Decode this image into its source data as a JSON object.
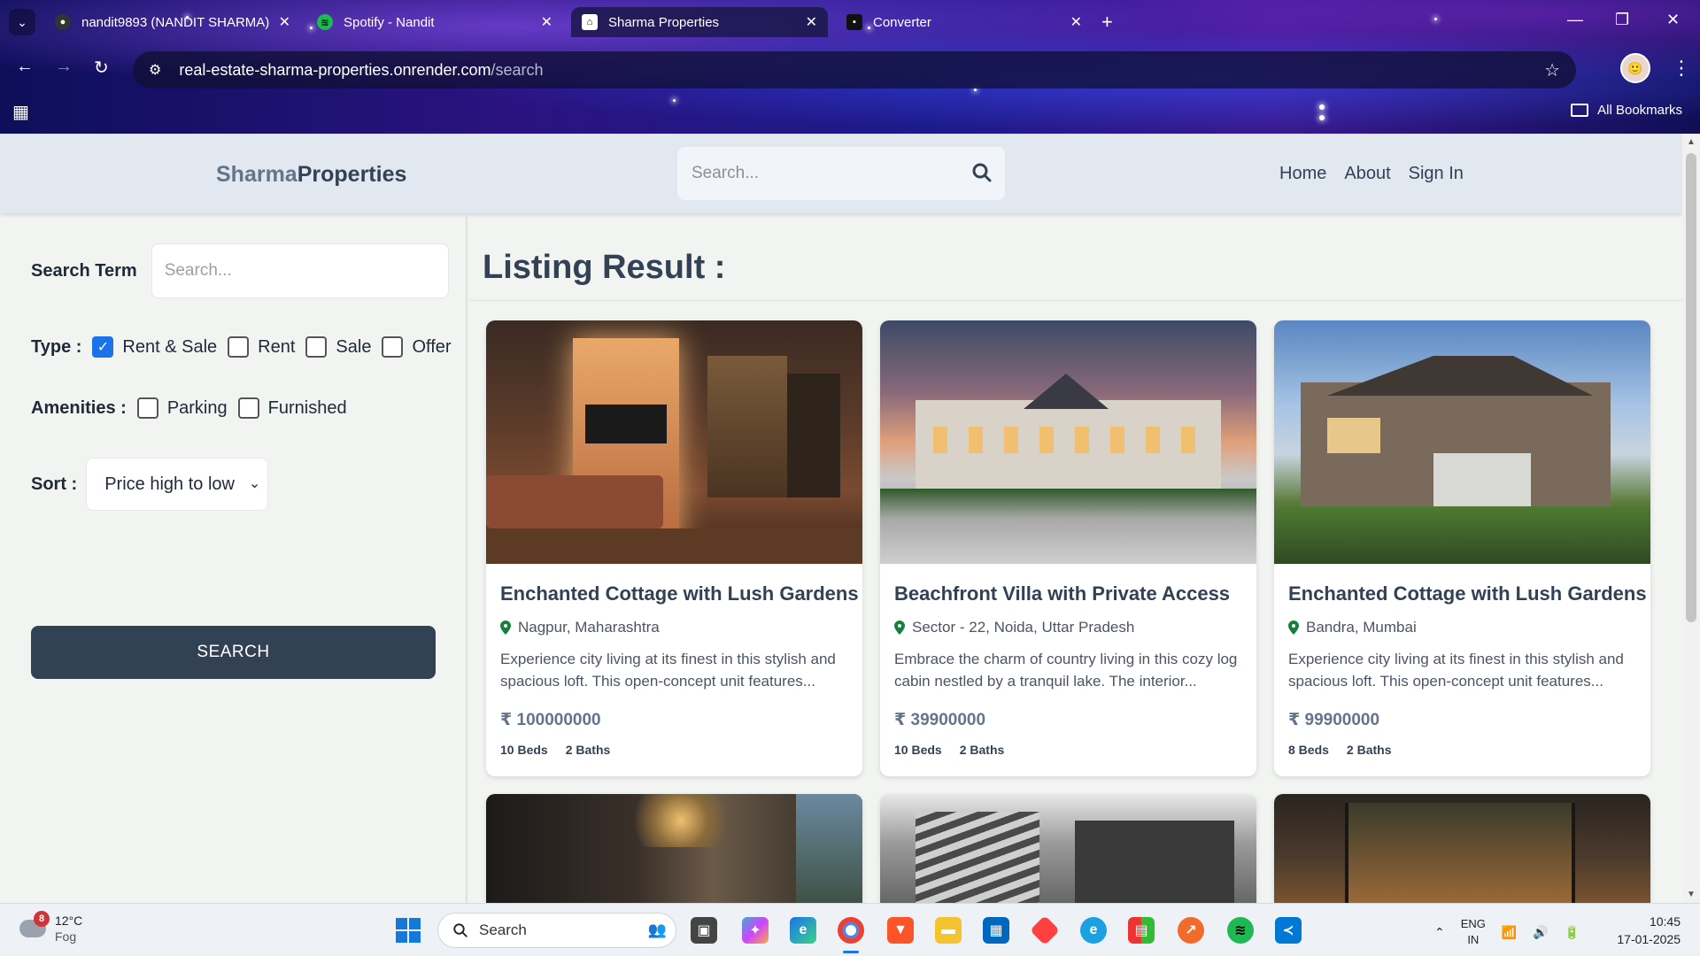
{
  "browser": {
    "tabs": [
      {
        "title": "nandit9893 (NANDIT SHARMA)",
        "icon": "github-icon"
      },
      {
        "title": "Spotify - Nandit",
        "icon": "spotify-icon"
      },
      {
        "title": "Sharma Properties",
        "icon": "site-icon",
        "active": true
      },
      {
        "title": "Converter",
        "icon": "converter-icon"
      }
    ],
    "url_host": "real-estate-sharma-properties.onrender.com",
    "url_path": "/search",
    "all_bookmarks": "All Bookmarks"
  },
  "site": {
    "logo_part1": "Sharma",
    "logo_part2": "Properties",
    "header_search_placeholder": "Search...",
    "nav": [
      "Home",
      "About",
      "Sign In"
    ]
  },
  "filters": {
    "search_term_label": "Search Term",
    "search_term_placeholder": "Search...",
    "type_label": "Type :",
    "types": [
      {
        "label": "Rent & Sale",
        "checked": true
      },
      {
        "label": "Rent",
        "checked": false
      },
      {
        "label": "Sale",
        "checked": false
      },
      {
        "label": "Offer",
        "checked": false
      }
    ],
    "amenities_label": "Amenities :",
    "amenities": [
      {
        "label": "Parking",
        "checked": false
      },
      {
        "label": "Furnished",
        "checked": false
      }
    ],
    "sort_label": "Sort :",
    "sort_value": "Price high to low",
    "search_button": "SEARCH"
  },
  "results": {
    "title": "Listing Result :",
    "listings": [
      {
        "title": "Enchanted Cottage with Lush Gardens",
        "location": "Nagpur, Maharashtra",
        "description": "Experience city living at its finest in this stylish and spacious loft. This open-concept unit features...",
        "price": "₹ 100000000",
        "beds": "10 Beds",
        "baths": "2 Baths"
      },
      {
        "title": "Beachfront Villa with Private Access",
        "location": "Sector - 22, Noida, Uttar Pradesh",
        "description": "Embrace the charm of country living in this cozy log cabin nestled by a tranquil lake. The interior...",
        "price": "₹ 39900000",
        "beds": "10 Beds",
        "baths": "2 Baths"
      },
      {
        "title": "Enchanted Cottage with Lush Gardens",
        "location": "Bandra, Mumbai",
        "description": "Experience city living at its finest in this stylish and spacious loft. This open-concept unit features...",
        "price": "₹ 99900000",
        "beds": "8 Beds",
        "baths": "2 Baths"
      }
    ]
  },
  "taskbar": {
    "weather_badge": "8",
    "temperature": "12°C",
    "condition": "Fog",
    "search_label": "Search",
    "lang": "ENG",
    "region": "IN",
    "time": "10:45",
    "date": "17-01-2025"
  }
}
